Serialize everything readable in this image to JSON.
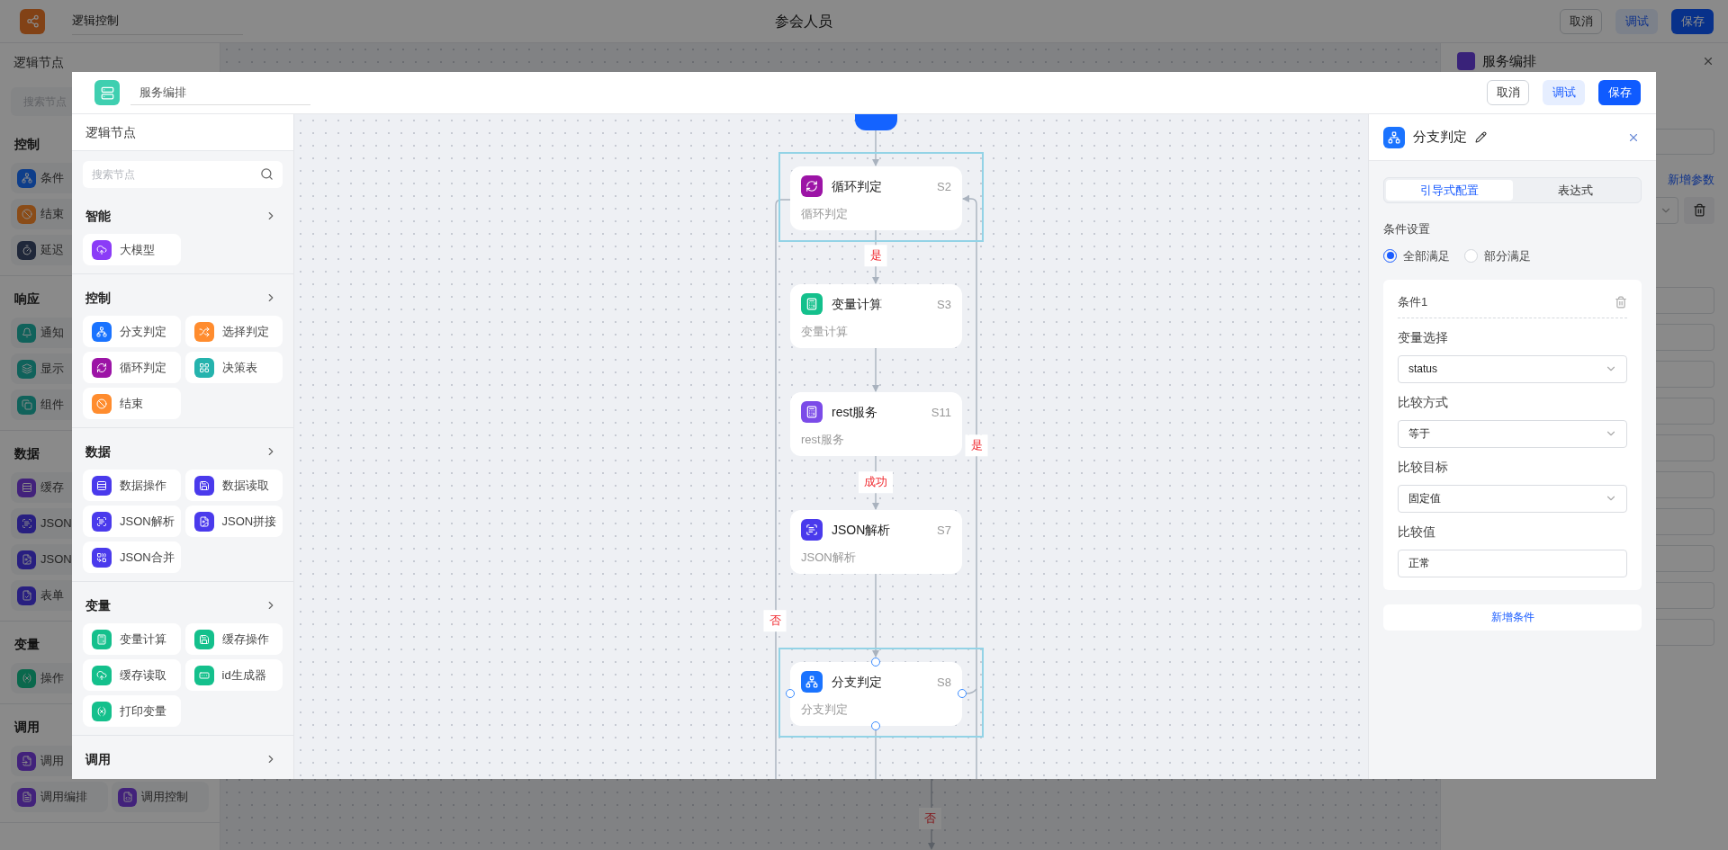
{
  "app": {
    "title_field": "逻辑控制",
    "page_title": "参会人员",
    "buttons": [
      {
        "label": "取消",
        "kind": "outline"
      },
      {
        "label": "调试",
        "kind": "light"
      },
      {
        "label": "保存",
        "kind": "primary"
      }
    ]
  },
  "bg_sidebar": {
    "title": "逻辑节点",
    "search_placeholder": "搜索节点",
    "sections": [
      {
        "title": "控制",
        "rows": [
          [
            {
              "label": "条件",
              "kind": "branch"
            }
          ],
          [
            {
              "label": "结束",
              "kind": "end"
            }
          ],
          [
            {
              "label": "延迟",
              "kind": "timer"
            }
          ]
        ]
      },
      {
        "title": "响应",
        "rows": [
          [
            {
              "label": "通知",
              "kind": "bell"
            }
          ],
          [
            {
              "label": "显示",
              "kind": "layers"
            }
          ],
          [
            {
              "label": "组件",
              "kind": "copy"
            }
          ]
        ]
      },
      {
        "title": "数据",
        "rows": [
          [
            {
              "label": "缓存",
              "kind": "data"
            }
          ],
          [
            {
              "label": "JSON",
              "kind": "parse"
            }
          ],
          [
            {
              "label": "JSON",
              "kind": "join"
            }
          ],
          [
            {
              "label": "表单",
              "kind": "form"
            }
          ]
        ]
      },
      {
        "title": "变量",
        "rows": [
          [
            {
              "label": "操作",
              "kind": "var"
            }
          ]
        ]
      },
      {
        "title": "调用",
        "rows": [
          [
            {
              "label": "调用",
              "kind": "call"
            }
          ],
          [
            {
              "label": "调用编排",
              "kind": "doc"
            },
            {
              "label": "调用控制",
              "kind": "code"
            }
          ]
        ]
      }
    ]
  },
  "bg_canvas": {
    "edge_label": "否"
  },
  "bg_panel": {
    "title": "服务编排",
    "add_link": "新增参数"
  },
  "modal": {
    "title_field": "服务编排",
    "buttons": [
      {
        "label": "取消",
        "kind": "outline"
      },
      {
        "label": "调试",
        "kind": "light"
      },
      {
        "label": "保存",
        "kind": "primary"
      }
    ],
    "palette": {
      "title": "逻辑节点",
      "search_placeholder": "搜索节点",
      "sections": [
        {
          "title": "智能",
          "items": [
            {
              "label": "大模型",
              "kind": "ai",
              "color": "#8b3cf7"
            }
          ]
        },
        {
          "title": "控制",
          "items": [
            {
              "label": "分支判定",
              "kind": "branch",
              "color": "#1a73ff"
            },
            {
              "label": "选择判定",
              "kind": "shuffle",
              "color": "#ff8c2e"
            },
            {
              "label": "循环判定",
              "kind": "loop",
              "color": "#9c14a6"
            },
            {
              "label": "决策表",
              "kind": "table",
              "color": "#25b3ad"
            },
            {
              "label": "结束",
              "kind": "end",
              "color": "#ff8c2e"
            }
          ]
        },
        {
          "title": "数据",
          "items": [
            {
              "label": "数据操作",
              "kind": "data",
              "color": "#4a3aec"
            },
            {
              "label": "数据读取",
              "kind": "save",
              "color": "#4a3aec"
            },
            {
              "label": "JSON解析",
              "kind": "parse",
              "color": "#4a3aec"
            },
            {
              "label": "JSON拼接",
              "kind": "join",
              "color": "#4a3aec"
            },
            {
              "label": "JSON合并",
              "kind": "merge",
              "color": "#4a3aec"
            }
          ]
        },
        {
          "title": "变量",
          "items": [
            {
              "label": "变量计算",
              "kind": "calc",
              "color": "#14c08c"
            },
            {
              "label": "缓存操作",
              "kind": "save",
              "color": "#14c08c"
            },
            {
              "label": "缓存读取",
              "kind": "cloud",
              "color": "#14c08c"
            },
            {
              "label": "id生成器",
              "kind": "id",
              "color": "#14c08c"
            },
            {
              "label": "打印变量",
              "kind": "var",
              "color": "#14c08c"
            }
          ]
        },
        {
          "title": "调用"
        }
      ]
    }
  },
  "canvas": {
    "nodes": [
      {
        "title": "循环判定",
        "id": "S2",
        "subtitle": "循环判定",
        "kind": "loop",
        "color": "#9c14a6",
        "selected": true,
        "handles": false
      },
      {
        "title": "变量计算",
        "id": "S3",
        "subtitle": "变量计算",
        "kind": "calc",
        "color": "#14c08c",
        "selected": false,
        "handles": false
      },
      {
        "title": "rest服务",
        "id": "S11",
        "subtitle": "rest服务",
        "kind": "calc",
        "color": "#7b4be8",
        "selected": false,
        "handles": false
      },
      {
        "title": "JSON解析",
        "id": "S7",
        "subtitle": "JSON解析",
        "kind": "parse",
        "color": "#4a3aec",
        "selected": false,
        "handles": false
      },
      {
        "title": "分支判定",
        "id": "S8",
        "subtitle": "分支判定",
        "kind": "branch",
        "color": "#1a73ff",
        "selected": true,
        "handles": true
      }
    ],
    "edge_labels": [
      "是",
      "成功",
      "否",
      "是"
    ]
  },
  "inspector": {
    "title": "分支判定",
    "kind": "branch",
    "color": "#1a73ff",
    "tabs": [
      {
        "label": "引导式配置",
        "selected": true
      },
      {
        "label": "表达式",
        "selected": false
      }
    ],
    "section_label": "条件设置",
    "match_options": [
      {
        "label": "全部满足",
        "selected": true
      },
      {
        "label": "部分满足",
        "selected": false
      }
    ],
    "conditions": [
      {
        "title": "条件1",
        "fields": [
          {
            "label": "变量选择",
            "value": "status",
            "kind": "select"
          },
          {
            "label": "比较方式",
            "value": "等于",
            "kind": "select"
          },
          {
            "label": "比较目标",
            "value": "固定值",
            "kind": "select"
          },
          {
            "label": "比较值",
            "value": "正常",
            "kind": "input"
          }
        ]
      }
    ],
    "add_button": "新增条件"
  }
}
